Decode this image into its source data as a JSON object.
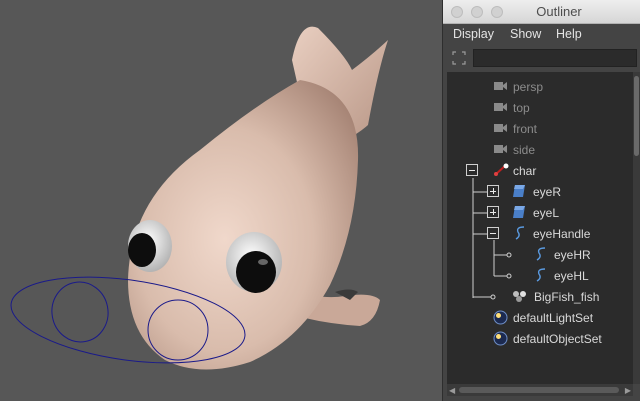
{
  "window": {
    "title": "Outliner"
  },
  "menu": [
    "Display",
    "Show",
    "Help"
  ],
  "filter": {
    "value": ""
  },
  "outliner_items": [
    {
      "label": "persp",
      "icon": "camera-icon",
      "dim": true
    },
    {
      "label": "top",
      "icon": "camera-icon",
      "dim": true
    },
    {
      "label": "front",
      "icon": "camera-icon",
      "dim": true
    },
    {
      "label": "side",
      "icon": "camera-icon",
      "dim": true
    },
    {
      "label": "char",
      "icon": "joint-icon",
      "expander": "collapse"
    },
    {
      "label": "eyeR",
      "icon": "mesh-icon",
      "expander": "expand"
    },
    {
      "label": "eyeL",
      "icon": "mesh-icon",
      "expander": "expand"
    },
    {
      "label": "eyeHandle",
      "icon": "curve-icon",
      "expander": "collapse"
    },
    {
      "label": "eyeHR",
      "icon": "curve-icon"
    },
    {
      "label": "eyeHL",
      "icon": "curve-icon"
    },
    {
      "label": "BigFish_fish",
      "icon": "group-mesh-icon"
    },
    {
      "label": "defaultLightSet",
      "icon": "set-icon"
    },
    {
      "label": "defaultObjectSet",
      "icon": "set-icon"
    }
  ],
  "colors": {
    "viewport_bg": "#575757",
    "fish_body": "#dcbfb0",
    "curve_blue": "#1a1a8a",
    "panel_bg": "#444444",
    "list_bg": "#2b2b2b",
    "text": "#d9d9d9"
  }
}
